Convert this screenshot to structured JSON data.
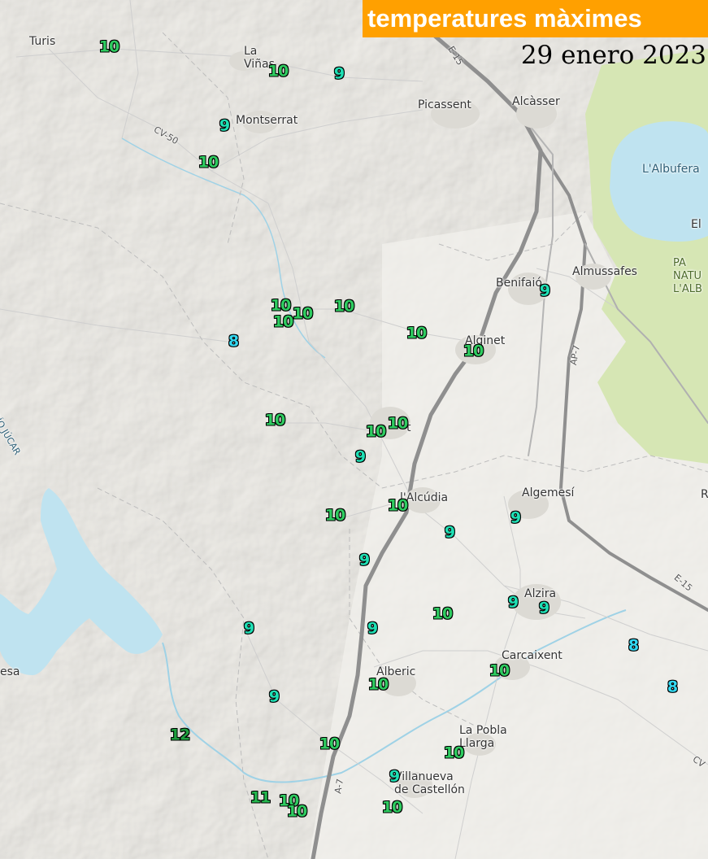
{
  "map": {
    "title": "temperatures màximes",
    "date": "29 enero 2023",
    "colors": {
      "title_banner": "#ffa000",
      "land": "#eceae4",
      "water": "#bfe3f0",
      "park": "#d6e6b4",
      "highway": "#8a8a8a",
      "temp_8": "#33d9f2",
      "temp_9": "#1fe0b5",
      "temp_10": "#2ecc60",
      "temp_11": "#24b84e",
      "temp_12": "#1e9f3f"
    },
    "places": [
      {
        "id": "turis",
        "name": "Turis"
      },
      {
        "id": "la-vinas",
        "name": "La\nViñas"
      },
      {
        "id": "montserrat",
        "name": "Montserrat"
      },
      {
        "id": "picassent",
        "name": "Picassent"
      },
      {
        "id": "alcasser",
        "name": "Alcàsser"
      },
      {
        "id": "albufera",
        "name": "L'Albufera"
      },
      {
        "id": "el",
        "name": "El"
      },
      {
        "id": "almussafes",
        "name": "Almussafes"
      },
      {
        "id": "benifaio",
        "name": "Benifaió"
      },
      {
        "id": "parc-natural",
        "name": "PA\nNATU\nL'ALB"
      },
      {
        "id": "alginet",
        "name": "Alginet"
      },
      {
        "id": "carlet",
        "name": "t"
      },
      {
        "id": "alcudia",
        "name": "l'Alcúdia"
      },
      {
        "id": "algemesi",
        "name": "Algemesí"
      },
      {
        "id": "r-edge",
        "name": "R"
      },
      {
        "id": "alzira",
        "name": "Alzira"
      },
      {
        "id": "carcaixent",
        "name": "Carcaixent"
      },
      {
        "id": "alberic",
        "name": "Alberic"
      },
      {
        "id": "la-pobla-llarga",
        "name": "La Pobla\nLlarga"
      },
      {
        "id": "villanueva",
        "name": "Villanueva\nde Castellón"
      },
      {
        "id": "esa",
        "name": "esa"
      },
      {
        "id": "rio-jucar",
        "name": "RÍO JÚCAR"
      }
    ],
    "roads": [
      {
        "id": "e15-top",
        "name": "E-15"
      },
      {
        "id": "cv50",
        "name": "CV-50"
      },
      {
        "id": "ap7",
        "name": "AP-7"
      },
      {
        "id": "e15-right",
        "name": "E-15"
      },
      {
        "id": "a7",
        "name": "A-7"
      },
      {
        "id": "cv-right",
        "name": "CV"
      }
    ],
    "temperatures": [
      {
        "value": 10
      },
      {
        "value": 10
      },
      {
        "value": 9
      },
      {
        "value": 9
      },
      {
        "value": 10
      },
      {
        "value": 10
      },
      {
        "value": 10
      },
      {
        "value": 10
      },
      {
        "value": 10
      },
      {
        "value": 8
      },
      {
        "value": 9
      },
      {
        "value": 10
      },
      {
        "value": 10
      },
      {
        "value": 10
      },
      {
        "value": 10
      },
      {
        "value": 10
      },
      {
        "value": 9
      },
      {
        "value": 10
      },
      {
        "value": 10
      },
      {
        "value": 9
      },
      {
        "value": 9
      },
      {
        "value": 9
      },
      {
        "value": 10
      },
      {
        "value": 9
      },
      {
        "value": 9
      },
      {
        "value": 9
      },
      {
        "value": 8
      },
      {
        "value": 10
      },
      {
        "value": 10
      },
      {
        "value": 9
      },
      {
        "value": 8
      },
      {
        "value": 9
      },
      {
        "value": 12
      },
      {
        "value": 10
      },
      {
        "value": 10
      },
      {
        "value": 9
      },
      {
        "value": 11
      },
      {
        "value": 10
      },
      {
        "value": 10
      },
      {
        "value": 10
      }
    ]
  }
}
